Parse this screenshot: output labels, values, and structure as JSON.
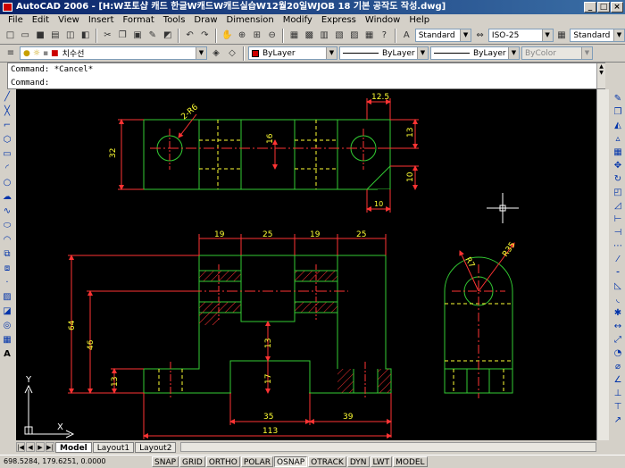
{
  "window": {
    "title": "AutoCAD 2006 - [H:W포토샵 캐드 한글W캐드W캐드실습W12월20일WJOB 18 기본 공작도 작성.dwg]"
  },
  "menu": [
    "File",
    "Edit",
    "View",
    "Insert",
    "Format",
    "Tools",
    "Draw",
    "Dimension",
    "Modify",
    "Express",
    "Window",
    "Help"
  ],
  "toolbar": {
    "text_style": "Standard",
    "dim_style": "ISO-25",
    "table_style": "Standard",
    "layer": "치수선",
    "color": "ByLayer",
    "linetype": "ByLayer",
    "lineweight": "ByLayer",
    "plot_style": "ByColor",
    "color_swatch": "#cc0000"
  },
  "command": {
    "line1": "Command: *Cancel*",
    "line2": "Command:"
  },
  "layout_tabs": [
    "Model",
    "Layout1",
    "Layout2"
  ],
  "status": {
    "coords": "698.5284, 179.6251, 0.0000",
    "toggles": [
      "SNAP",
      "GRID",
      "ORTHO",
      "POLAR",
      "OSNAP",
      "OTRACK",
      "DYN",
      "LWT",
      "MODEL"
    ]
  },
  "drawing": {
    "colors": {
      "outline": "#33cc33",
      "center": "#ff3333",
      "hidden": "#ffff33",
      "dimension": "#ff3333",
      "text": "#ffff33",
      "hatch": "#ff3333"
    },
    "dims": {
      "top_12_5": "12.5",
      "top_r6": "2-R6",
      "top_32": "32",
      "top_16": "16",
      "top_13": "13",
      "top_10a": "10",
      "top_10b": "10",
      "front_19a": "19",
      "front_25a": "25",
      "front_19b": "19",
      "front_25b": "25",
      "front_64": "64",
      "front_46": "46",
      "front_13a": "13",
      "front_13b": "13",
      "front_17": "17",
      "front_35": "35",
      "front_39": "39",
      "front_113": "113",
      "side_r7": "R7",
      "side_r35": "R35"
    },
    "ucs": {
      "x": "X",
      "y": "Y"
    }
  }
}
